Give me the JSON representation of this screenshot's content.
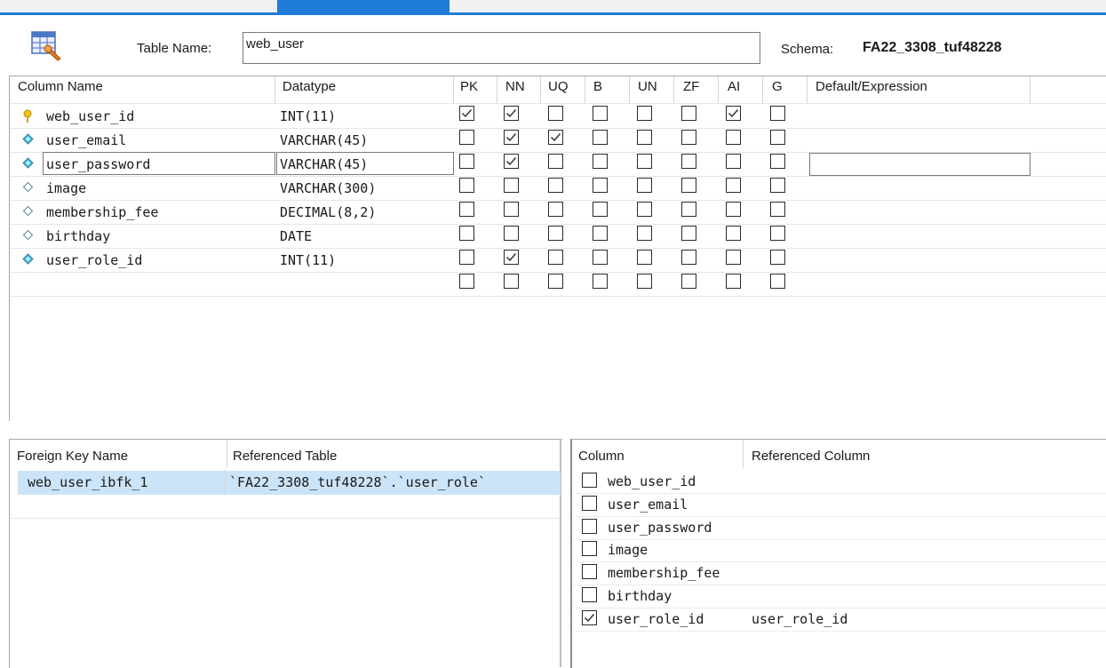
{
  "header": {
    "table_name_label": "Table Name:",
    "table_name_value": "web_user",
    "schema_label": "Schema:",
    "schema_value": "FA22_3308_tuf48228"
  },
  "columns_grid": {
    "headers": [
      "Column Name",
      "Datatype",
      "PK",
      "NN",
      "UQ",
      "B",
      "UN",
      "ZF",
      "AI",
      "G",
      "Default/Expression"
    ],
    "rows": [
      {
        "name": "web_user_id",
        "datatype": "INT(11)",
        "icon": "primary-key-icon",
        "flags": [
          true,
          true,
          false,
          false,
          false,
          false,
          true,
          false
        ]
      },
      {
        "name": "user_email",
        "datatype": "VARCHAR(45)",
        "icon": "column-diamond-filled-icon",
        "flags": [
          false,
          true,
          true,
          false,
          false,
          false,
          false,
          false
        ]
      },
      {
        "name": "user_password",
        "datatype": "VARCHAR(45)",
        "icon": "column-diamond-filled-icon",
        "flags": [
          false,
          true,
          false,
          false,
          false,
          false,
          false,
          false
        ]
      },
      {
        "name": "image",
        "datatype": "VARCHAR(300)",
        "icon": "column-diamond-empty-icon",
        "flags": [
          false,
          false,
          false,
          false,
          false,
          false,
          false,
          false
        ]
      },
      {
        "name": "membership_fee",
        "datatype": "DECIMAL(8,2)",
        "icon": "column-diamond-empty-icon",
        "flags": [
          false,
          false,
          false,
          false,
          false,
          false,
          false,
          false
        ]
      },
      {
        "name": "birthday",
        "datatype": "DATE",
        "icon": "column-diamond-empty-icon",
        "flags": [
          false,
          false,
          false,
          false,
          false,
          false,
          false,
          false
        ]
      },
      {
        "name": "user_role_id",
        "datatype": "INT(11)",
        "icon": "column-diamond-filled-icon",
        "flags": [
          false,
          true,
          false,
          false,
          false,
          false,
          false,
          false
        ]
      },
      {
        "name": "",
        "datatype": "",
        "icon": "",
        "flags": [
          false,
          false,
          false,
          false,
          false,
          false,
          false,
          false
        ]
      }
    ]
  },
  "foreign_keys": {
    "headers": [
      "Foreign Key Name",
      "Referenced Table"
    ],
    "rows": [
      {
        "name": "web_user_ibfk_1",
        "referenced_table": "`FA22_3308_tuf48228`.`user_role`"
      }
    ]
  },
  "fk_columns": {
    "headers": [
      "Column",
      "Referenced Column"
    ],
    "rows": [
      {
        "column": "web_user_id",
        "checked": false,
        "referenced": ""
      },
      {
        "column": "user_email",
        "checked": false,
        "referenced": ""
      },
      {
        "column": "user_password",
        "checked": false,
        "referenced": ""
      },
      {
        "column": "image",
        "checked": false,
        "referenced": ""
      },
      {
        "column": "membership_fee",
        "checked": false,
        "referenced": ""
      },
      {
        "column": "birthday",
        "checked": false,
        "referenced": ""
      },
      {
        "column": "user_role_id",
        "checked": true,
        "referenced": "user_role_id"
      }
    ]
  },
  "colors": {
    "accent": "#1f7bd8",
    "selection": "#cce4f7",
    "key_icon": "#f2c21b",
    "diamond": "#3fb6d9"
  }
}
